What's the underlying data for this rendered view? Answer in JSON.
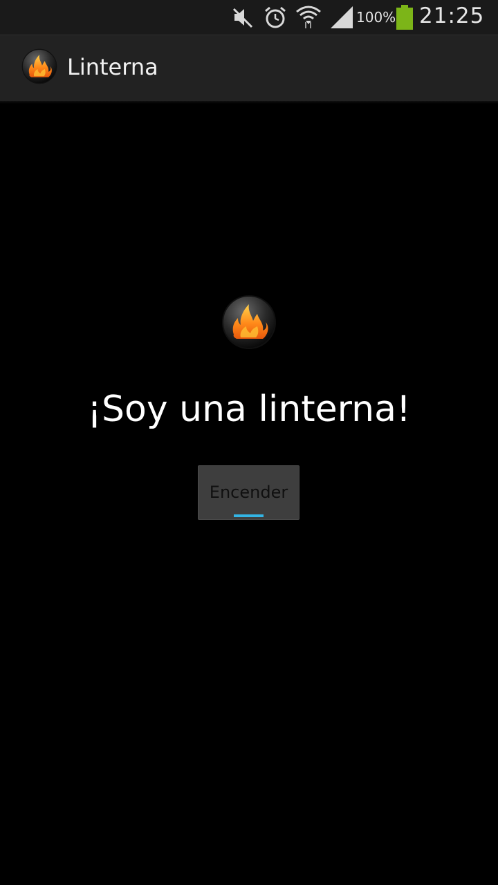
{
  "status_bar": {
    "battery_percent": "100%",
    "clock": "21:25",
    "icons": [
      "muted-icon",
      "alarm-icon",
      "wifi-icon",
      "signal-icon",
      "battery-icon"
    ],
    "battery_color": "#7cb518"
  },
  "action_bar": {
    "title": "Linterna",
    "icon": "flame-icon"
  },
  "main": {
    "icon": "flame-icon",
    "headline": "¡Soy una linterna!",
    "button_label": "Encender",
    "button_indicator_color": "#33b5e5"
  }
}
